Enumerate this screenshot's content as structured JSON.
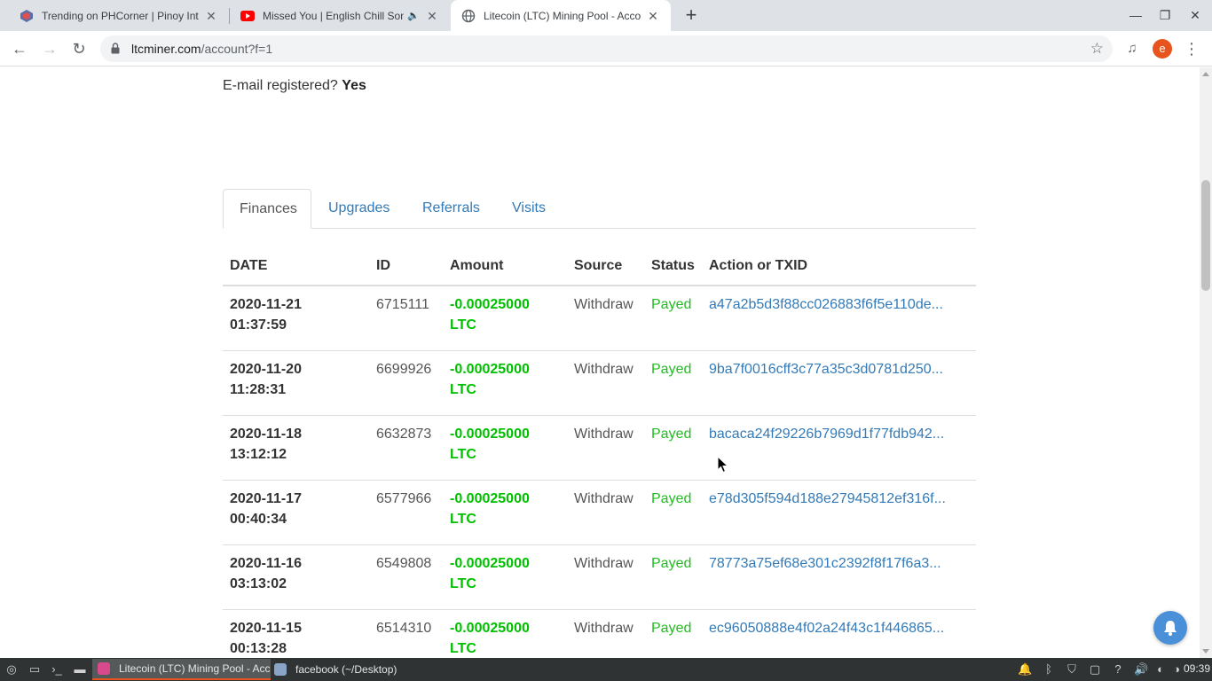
{
  "browser": {
    "tabs": [
      {
        "title": "Trending on PHCorner | Pinoy Inter",
        "favicon": "phcorner-icon",
        "audio": false,
        "active": false
      },
      {
        "title": "Missed You | English Chill Song",
        "favicon": "youtube-icon",
        "audio": true,
        "active": false
      },
      {
        "title": "Litecoin (LTC) Mining Pool - Accoun",
        "favicon": "globe-icon",
        "audio": false,
        "active": true
      }
    ],
    "url_domain": "ltcminer.com",
    "url_path": "/account?f=1",
    "avatar_letter": "e"
  },
  "page": {
    "email_label": "E-mail registered?",
    "email_value": "Yes",
    "tabs": [
      {
        "label": "Finances",
        "active": true
      },
      {
        "label": "Upgrades",
        "active": false
      },
      {
        "label": "Referrals",
        "active": false
      },
      {
        "label": "Visits",
        "active": false
      }
    ],
    "table": {
      "headers": [
        "DATE",
        "ID",
        "Amount",
        "Source",
        "Status",
        "Action or TXID"
      ],
      "rows": [
        {
          "date": "2020-11-21",
          "time": "01:37:59",
          "id": "6715111",
          "amount": "-0.00025000",
          "unit": "LTC",
          "source": "Withdraw",
          "status": "Payed",
          "txid": "a47a2b5d3f88cc026883f6f5e110de..."
        },
        {
          "date": "2020-11-20",
          "time": "11:28:31",
          "id": "6699926",
          "amount": "-0.00025000",
          "unit": "LTC",
          "source": "Withdraw",
          "status": "Payed",
          "txid": "9ba7f0016cff3c77a35c3d0781d250..."
        },
        {
          "date": "2020-11-18",
          "time": "13:12:12",
          "id": "6632873",
          "amount": "-0.00025000",
          "unit": "LTC",
          "source": "Withdraw",
          "status": "Payed",
          "txid": "bacaca24f29226b7969d1f77fdb942..."
        },
        {
          "date": "2020-11-17",
          "time": "00:40:34",
          "id": "6577966",
          "amount": "-0.00025000",
          "unit": "LTC",
          "source": "Withdraw",
          "status": "Payed",
          "txid": "e78d305f594d188e27945812ef316f..."
        },
        {
          "date": "2020-11-16",
          "time": "03:13:02",
          "id": "6549808",
          "amount": "-0.00025000",
          "unit": "LTC",
          "source": "Withdraw",
          "status": "Payed",
          "txid": "78773a75ef68e301c2392f8f17f6a3..."
        },
        {
          "date": "2020-11-15",
          "time": "00:13:28",
          "id": "6514310",
          "amount": "-0.00025000",
          "unit": "LTC",
          "source": "Withdraw",
          "status": "Payed",
          "txid": "ec96050888e4f02a24f43c1f446865..."
        }
      ]
    }
  },
  "taskbar": {
    "tasks": [
      {
        "label": "Litecoin (LTC) Mining Pool - Acc...",
        "active": true
      },
      {
        "label": "facebook (~/Desktop)",
        "active": false
      }
    ],
    "clock": "09:39"
  },
  "colors": {
    "link": "#337ab7",
    "amount_negative": "#00c000",
    "status_payed": "#22bb22",
    "taskbar_accent": "#e8541e"
  }
}
